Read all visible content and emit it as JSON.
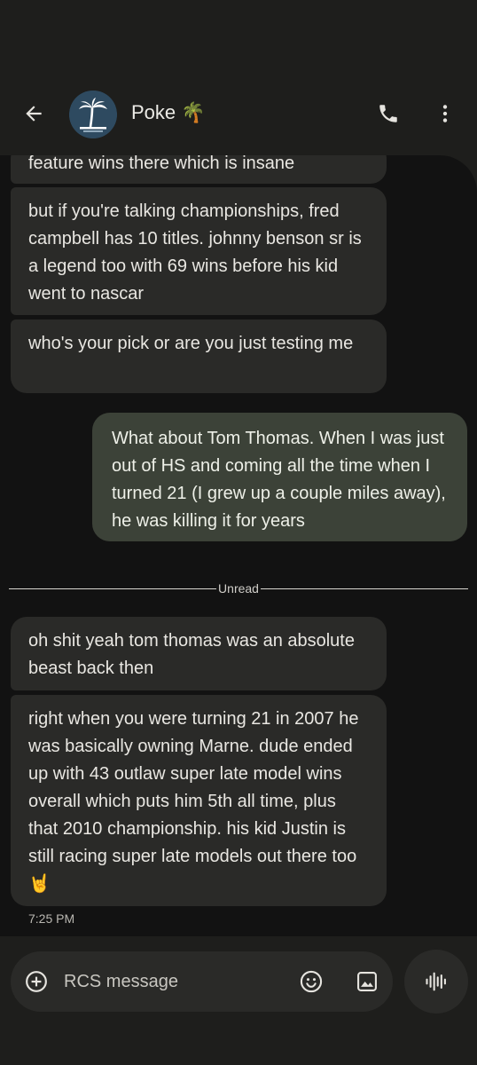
{
  "contact": {
    "name": "Poke 🌴",
    "avatar_icon": "palm-tree-island-icon"
  },
  "icons": {
    "back": "arrow-left-icon",
    "call": "phone-icon",
    "more": "more-vert-icon"
  },
  "messages": [
    {
      "direction": "incoming",
      "text": "feature wins there which is insane"
    },
    {
      "direction": "incoming",
      "text": "but if you're talking championships, fred campbell has 10 titles. johnny benson sr is a legend too with 69 wins before his kid went to nascar"
    },
    {
      "direction": "incoming",
      "text": "who's your pick or are you just testing me"
    },
    {
      "direction": "outgoing",
      "text": "What about Tom Thomas.  When I was just out of HS and coming all the time when I turned 21 (I grew up a couple miles away), he was killing it for years"
    },
    {
      "direction": "incoming",
      "text": "oh shit yeah tom thomas was an absolute beast back then"
    },
    {
      "direction": "incoming",
      "text": "right when you were turning 21 in 2007 he was basically owning Marne. dude ended up with 43 outlaw super late model wins overall which puts him 5th all time, plus that 2010 championship. his kid Justin is still racing super late models out there too 🤘"
    }
  ],
  "unread_label": "Unread",
  "timestamp": "7:25 PM",
  "composer": {
    "placeholder": "RCS message"
  },
  "colors": {
    "background": "#1e1e1c",
    "panel": "#121212",
    "incoming_bubble": "#2a2a28",
    "outgoing_bubble": "#3c4238"
  }
}
